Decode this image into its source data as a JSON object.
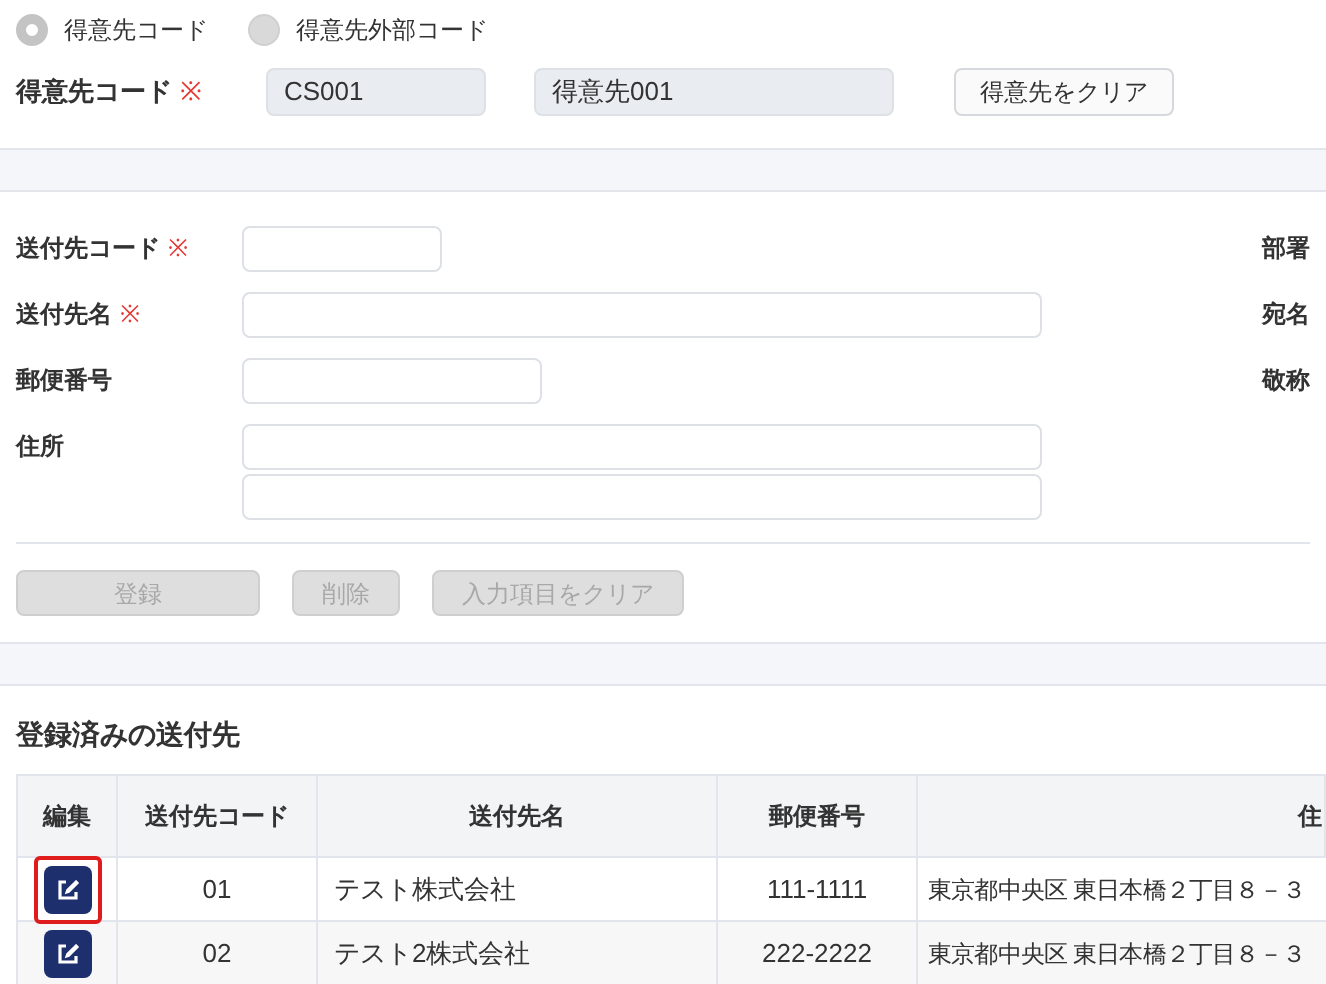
{
  "customer_mode": [
    {
      "label": "得意先コード",
      "selected": true
    },
    {
      "label": "得意先外部コード",
      "selected": false
    }
  ],
  "customer": {
    "label": "得意先コード",
    "required_mark": "※",
    "code": "CS001",
    "name": "得意先001",
    "clear_button": "得意先をクリア"
  },
  "form": {
    "fields": [
      {
        "label": "送付先コード",
        "required": true,
        "mark": "※",
        "kind": "short"
      },
      {
        "label": "送付先名",
        "required": true,
        "mark": "※",
        "kind": "long"
      },
      {
        "label": "郵便番号",
        "required": false,
        "kind": "medium"
      },
      {
        "label": "住所",
        "required": false,
        "kind": "double"
      }
    ],
    "right_labels": [
      "部署",
      "宛名",
      "敬称"
    ],
    "buttons": [
      {
        "label": "登録",
        "disabled": true
      },
      {
        "label": "削除",
        "disabled": true
      },
      {
        "label": "入力項目をクリア",
        "disabled": true
      }
    ]
  },
  "registered": {
    "title": "登録済みの送付先",
    "columns": [
      "編集",
      "送付先コード",
      "送付先名",
      "郵便番号",
      "住"
    ],
    "rows": [
      {
        "code": "01",
        "name": "テスト株式会社",
        "zip": "111-1111",
        "address": "東京都中央区 東日本橋２丁目８－３",
        "highlighted": true
      },
      {
        "code": "02",
        "name": "テスト2株式会社",
        "zip": "222-2222",
        "address": "東京都中央区 東日本橋２丁目８－３",
        "highlighted": false
      }
    ]
  }
}
